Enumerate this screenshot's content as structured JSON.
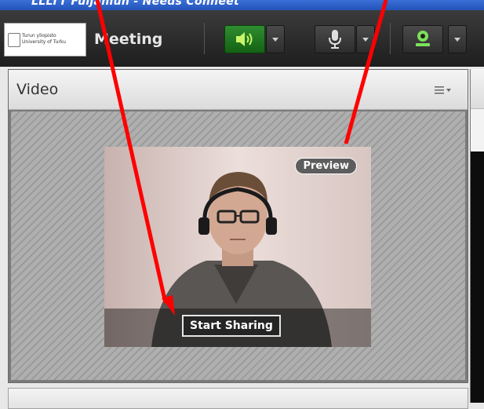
{
  "window": {
    "title": "LLLTT Fuljaniun - Needs Conneet"
  },
  "toolbar": {
    "logo_line1": "Turun yliopisto",
    "logo_line2": "University of Turku",
    "meeting_menu": "Meeting",
    "speaker_icon": "speaker-on-icon",
    "mic_icon": "microphone-icon",
    "webcam_icon": "webcam-icon",
    "accent_green": "#2f8d2f"
  },
  "video_pod": {
    "title": "Video",
    "menu_icon": "pod-options-icon",
    "preview_badge": "Preview",
    "start_sharing_label": "Start Sharing"
  },
  "annotations": {
    "arrow_color": "#ff0000"
  }
}
